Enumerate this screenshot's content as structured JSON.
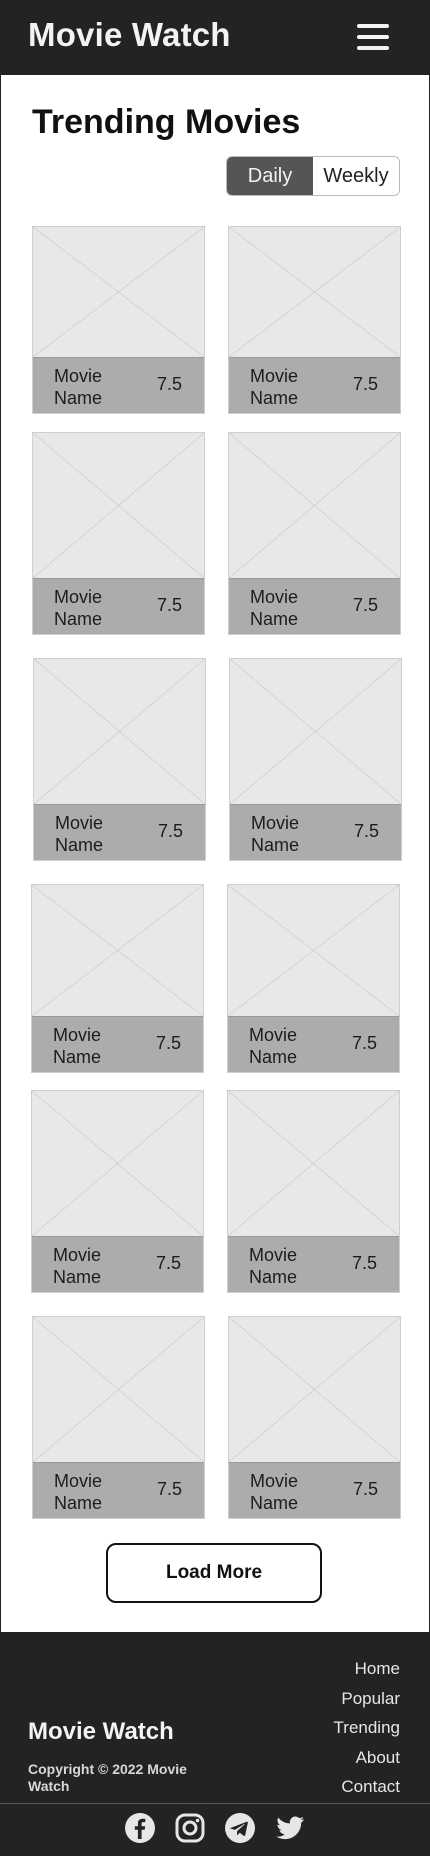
{
  "header": {
    "brand": "Movie Watch",
    "menu_icon": "hamburger-menu-icon"
  },
  "main": {
    "title": "Trending Movies",
    "toggle": {
      "options": [
        "Daily",
        "Weekly"
      ],
      "selected": "Daily"
    },
    "movies": [
      {
        "name": "Movie Name",
        "rating": "7.5"
      },
      {
        "name": "Movie Name",
        "rating": "7.5"
      },
      {
        "name": "Movie Name",
        "rating": "7.5"
      },
      {
        "name": "Movie Name",
        "rating": "7.5"
      },
      {
        "name": "Movie Name",
        "rating": "7.5"
      },
      {
        "name": "Movie Name",
        "rating": "7.5"
      },
      {
        "name": "Movie Name",
        "rating": "7.5"
      },
      {
        "name": "Movie Name",
        "rating": "7.5"
      },
      {
        "name": "Movie Name",
        "rating": "7.5"
      },
      {
        "name": "Movie Name",
        "rating": "7.5"
      },
      {
        "name": "Movie Name",
        "rating": "7.5"
      },
      {
        "name": "Movie Name",
        "rating": "7.5"
      }
    ],
    "load_more": "Load More"
  },
  "footer": {
    "brand": "Movie Watch",
    "copyright": "Copyright © 2022 Movie Watch",
    "links": [
      "Home",
      "Popular",
      "Trending",
      "About",
      "Contact"
    ],
    "social_icons": [
      "facebook-icon",
      "instagram-icon",
      "telegram-icon",
      "twitter-icon"
    ]
  },
  "colors": {
    "header_bg": "#232323",
    "caption_bg": "#acacac",
    "poster_bg": "#e8e8e8",
    "toggle_active": "#555555"
  }
}
